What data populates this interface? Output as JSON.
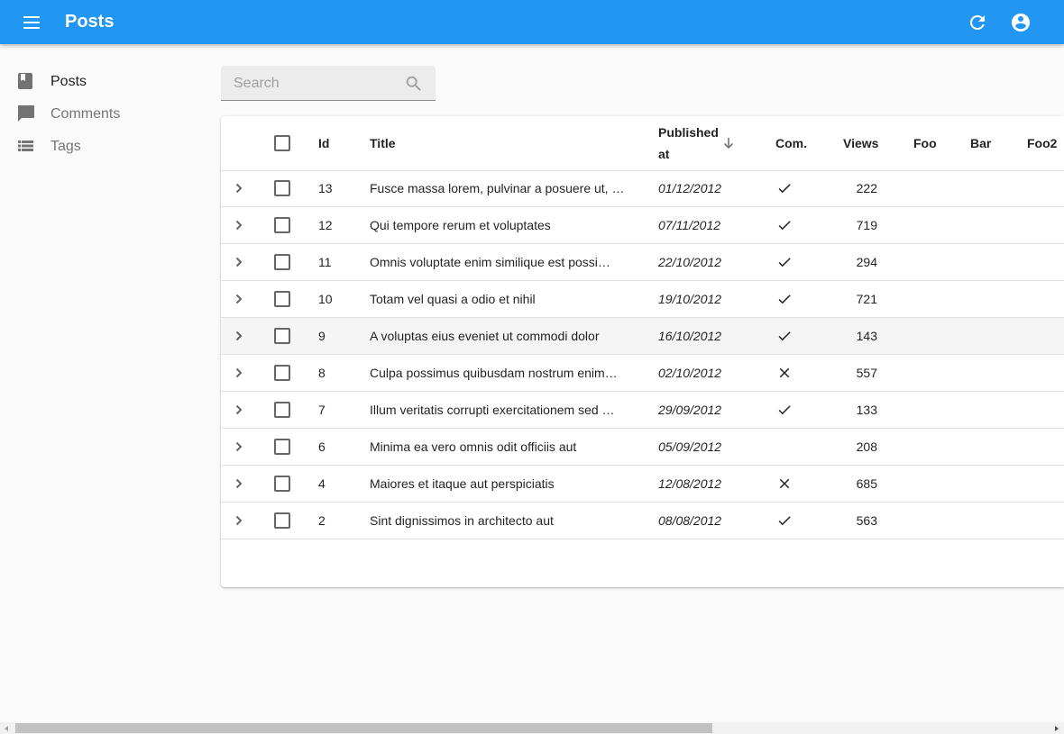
{
  "app": {
    "title": "Posts"
  },
  "sidebar": {
    "items": [
      {
        "label": "Posts",
        "icon": "book-icon",
        "active": true
      },
      {
        "label": "Comments",
        "icon": "chat-bubble-icon",
        "active": false
      },
      {
        "label": "Tags",
        "icon": "list-icon",
        "active": false
      }
    ]
  },
  "search": {
    "placeholder": "Search",
    "value": ""
  },
  "table": {
    "headers": {
      "id": "Id",
      "title": "Title",
      "published_line1": "Published",
      "published_line2": "at",
      "com": "Com.",
      "views": "Views",
      "foo": "Foo",
      "bar": "Bar",
      "foo2": "Foo2"
    },
    "sort": {
      "column": "published_at",
      "direction": "desc"
    },
    "rows": [
      {
        "id": "13",
        "title": "Fusce massa lorem, pulvinar a posuere ut, …",
        "published": "01/12/2012",
        "commentable": "yes",
        "views": "222"
      },
      {
        "id": "12",
        "title": "Qui tempore rerum et voluptates",
        "published": "07/11/2012",
        "commentable": "yes",
        "views": "719"
      },
      {
        "id": "11",
        "title": "Omnis voluptate enim similique est possi…",
        "published": "22/10/2012",
        "commentable": "yes",
        "views": "294"
      },
      {
        "id": "10",
        "title": "Totam vel quasi a odio et nihil",
        "published": "19/10/2012",
        "commentable": "yes",
        "views": "721"
      },
      {
        "id": "9",
        "title": "A voluptas eius eveniet ut commodi dolor",
        "published": "16/10/2012",
        "commentable": "yes",
        "views": "143"
      },
      {
        "id": "8",
        "title": "Culpa possimus quibusdam nostrum enim…",
        "published": "02/10/2012",
        "commentable": "no",
        "views": "557"
      },
      {
        "id": "7",
        "title": "Illum veritatis corrupti exercitationem sed …",
        "published": "29/09/2012",
        "commentable": "yes",
        "views": "133"
      },
      {
        "id": "6",
        "title": "Minima ea vero omnis odit officiis aut",
        "published": "05/09/2012",
        "commentable": "",
        "views": "208"
      },
      {
        "id": "4",
        "title": "Maiores et itaque aut perspiciatis",
        "published": "12/08/2012",
        "commentable": "no",
        "views": "685"
      },
      {
        "id": "2",
        "title": "Sint dignissimos in architecto aut",
        "published": "08/08/2012",
        "commentable": "yes",
        "views": "563"
      }
    ]
  },
  "colors": {
    "appbar": "#2196f3",
    "background": "#fafafa"
  }
}
